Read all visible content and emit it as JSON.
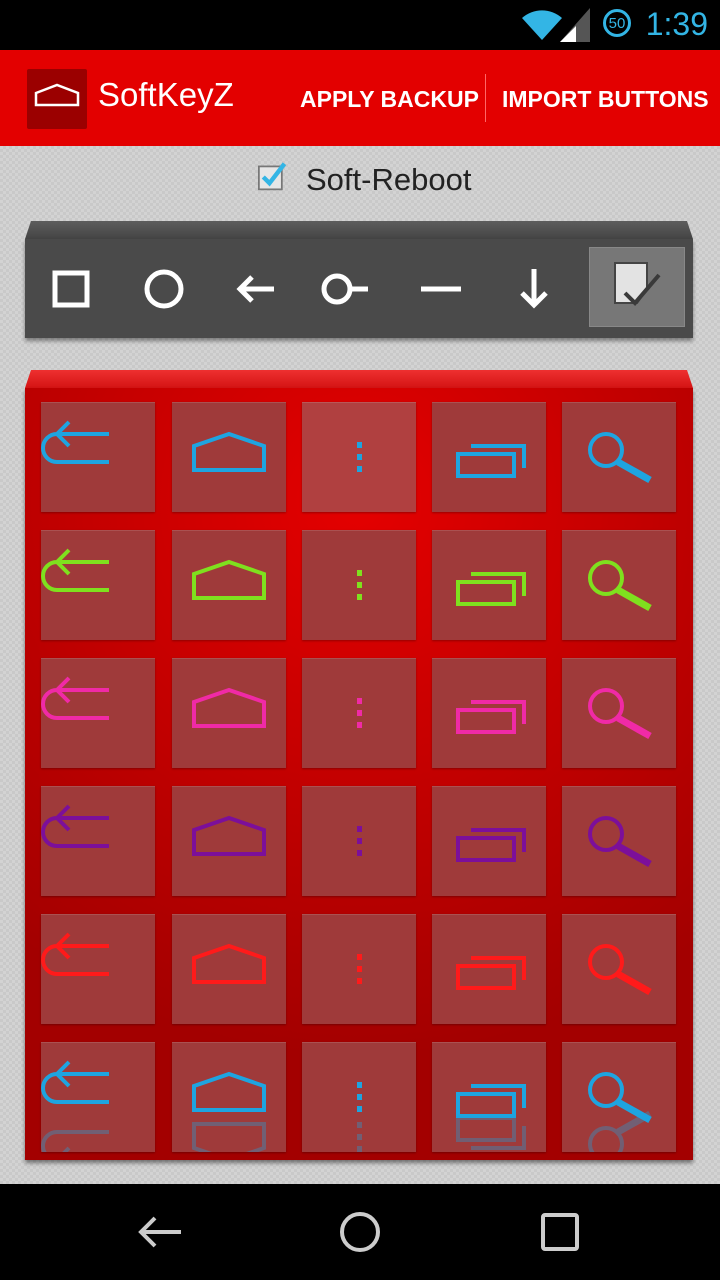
{
  "status_bar": {
    "time": "1:39",
    "battery_level": "50"
  },
  "action_bar": {
    "app_title": "SoftKeyZ",
    "apply_backup": "APPLY BACKUP",
    "import_buttons": "IMPORT BUTTONS"
  },
  "soft_reboot": {
    "label": "Soft-Reboot",
    "checked": true
  },
  "toolbar": {
    "icons": [
      "square-icon",
      "circle-icon",
      "arrow-left-icon",
      "circle-line-icon",
      "minus-icon",
      "arrow-down-icon"
    ],
    "apply_icon": "checked-document-icon"
  },
  "button_grid": {
    "columns": [
      "back-icon",
      "home-icon",
      "menu-icon",
      "recents-icon",
      "search-icon"
    ],
    "rows": [
      {
        "color": "#1ea4e0"
      },
      {
        "color": "#7fe01e"
      },
      {
        "color": "#f02aa6"
      },
      {
        "color": "#7c0f9a"
      },
      {
        "color": "#ff1a1a"
      },
      {
        "color": "#1ea4e0",
        "reflection": true
      }
    ]
  },
  "nav_bar": {
    "icons": [
      "back-icon",
      "home-icon",
      "recents-icon"
    ]
  }
}
